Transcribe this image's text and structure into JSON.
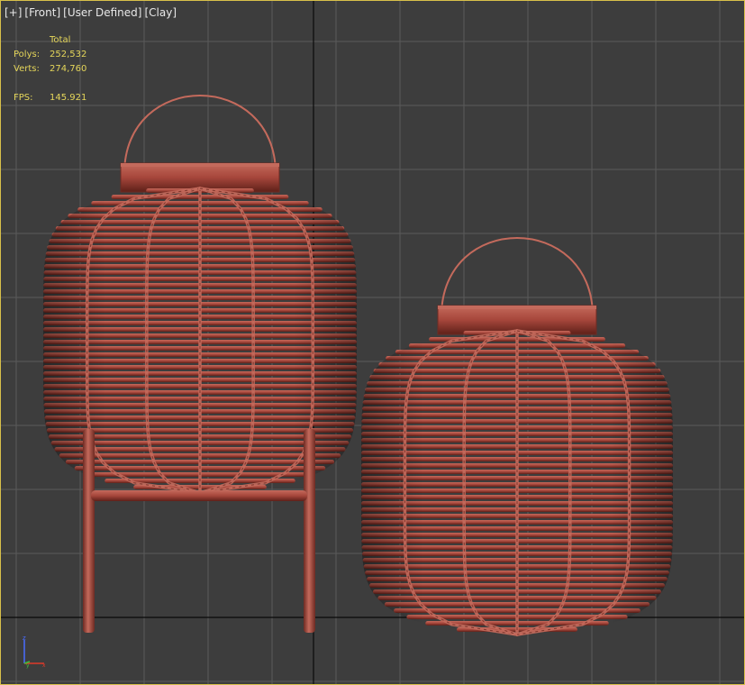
{
  "viewport": {
    "label_parts": [
      "[+]",
      "[Front]",
      "[User Defined]",
      "[Clay]"
    ]
  },
  "stats": {
    "header": "Total",
    "polys_label": "Polys:",
    "polys_value": "252,532",
    "verts_label": "Verts:",
    "verts_value": "274,760",
    "fps_label": "FPS:",
    "fps_value": "145.921"
  },
  "gizmo": {
    "z_label": "z",
    "y_label": "y",
    "x_label": "x"
  },
  "colors": {
    "background": "#3d3d3d",
    "grid": "#5a5a5a",
    "grid_axis": "#0a0a0a",
    "border": "#d8c04a",
    "stats_text": "#e5d65a",
    "clay": "#a8473c",
    "clay_dark": "#6e2a22",
    "clay_light": "#c46a5c"
  },
  "objects": [
    {
      "name": "lantern-with-stand"
    },
    {
      "name": "lantern"
    }
  ]
}
